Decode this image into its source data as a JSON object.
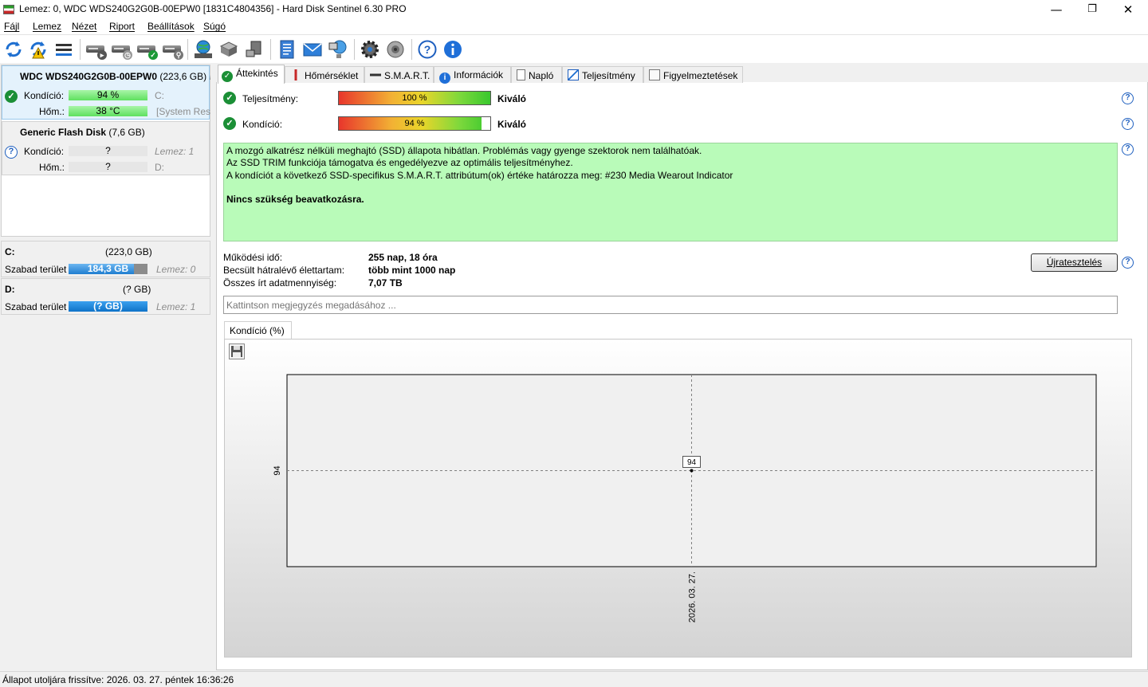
{
  "window": {
    "title": "Lemez: 0, WDC WDS240G2G0B-00EPW0 [1831C4804356]  -  Hard Disk Sentinel 6.30 PRO",
    "min_icon": "minimize-icon",
    "max_icon": "restore-icon",
    "close_icon": "close-icon"
  },
  "menu": {
    "items": [
      "Fájl",
      "Lemez",
      "Nézet",
      "Riport",
      "Beállítások",
      "Súgó"
    ]
  },
  "toolbar": {
    "icons": [
      "refresh-icon",
      "refresh-warning-icon",
      "disk-list-icon",
      "disk-test-icon",
      "disk-schedule-icon",
      "disk-ok-icon",
      "disk-search-icon",
      "globe-disk-icon",
      "disk-stack-icon",
      "disk-usb-icon",
      "report-icon",
      "mail-icon",
      "network-icon",
      "settings-icon",
      "sound-icon",
      "help-icon",
      "info-icon"
    ]
  },
  "disks": [
    {
      "name": "WDC WDS240G2G0B-00EPW0",
      "size": "(223,6 GB)",
      "suffix": "L",
      "status": "ok",
      "cond_label": "Kondíció:",
      "cond_value": "94 %",
      "cond_note": "C:",
      "temp_label": "Hőm.:",
      "temp_value": "38 °C",
      "temp_note": "[System Rese"
    },
    {
      "name": "Generic Flash Disk",
      "size": "(7,6 GB)",
      "status": "unknown",
      "cond_label": "Kondíció:",
      "cond_value": "?",
      "cond_note": "Lemez: 1",
      "temp_label": "Hőm.:",
      "temp_value": "?",
      "temp_note": "D:"
    }
  ],
  "volumes": [
    {
      "letter": "C:",
      "size": "(223,0 GB)",
      "free_label": "Szabad terület",
      "free_value": "184,3 GB",
      "disk_note": "Lemez: 0",
      "free_fraction": 0.83
    },
    {
      "letter": "D:",
      "size": "(? GB)",
      "free_label": "Szabad terület",
      "free_value": "(? GB)",
      "disk_note": "Lemez: 1",
      "free_fraction": 1.0
    }
  ],
  "tabs": [
    "Áttekintés",
    "Hőmérséklet",
    "S.M.A.R.T.",
    "Információk",
    "Napló",
    "Teljesítmény",
    "Figyelmeztetések"
  ],
  "overview": {
    "perf_label": "Teljesítmény:",
    "perf_value": "100 %",
    "perf_fraction": 1.0,
    "perf_rating": "Kiváló",
    "cond_label": "Kondíció:",
    "cond_value": "94 %",
    "cond_fraction": 0.94,
    "cond_rating": "Kiváló",
    "message_lines": [
      "A mozgó alkatrész nélküli meghajtó (SSD) állapota hibátlan. Problémás vagy gyenge szektorok nem találhatóak.",
      "Az SSD TRIM funkciója támogatva és engedélyezve az optimális teljesítményhez.",
      "A kondíciót a következő SSD-specifikus S.M.A.R.T. attribútum(ok) értéke határozza meg:  #230 Media Wearout Indicator"
    ],
    "message_bold": "Nincs szükség beavatkozásra.",
    "uptime_label": "Működési idő:",
    "uptime_value": "255 nap, 18 óra",
    "remaining_label": "Becsült hátralévő élettartam:",
    "remaining_value": "több mint 1000 nap",
    "written_label": "Összes írt adatmennyiség:",
    "written_value": "7,07 TB",
    "retest_button": "Újratesztelés",
    "note_placeholder": "Kattintson megjegyzés megadásához ...",
    "chart_tab": "Kondíció  (%)",
    "save_icon": "save-icon"
  },
  "chart_data": {
    "type": "line",
    "x": [
      "2026. 03. 27."
    ],
    "series": [
      {
        "values": [
          94
        ]
      }
    ],
    "y_tick_labels": [
      "94"
    ],
    "data_labels": [
      "94"
    ],
    "title": "",
    "xlabel": "",
    "ylabel": "",
    "grid": true
  },
  "status": {
    "text": "Állapot utoljára frissítve: 2026. 03. 27. péntek 16:36:26"
  }
}
